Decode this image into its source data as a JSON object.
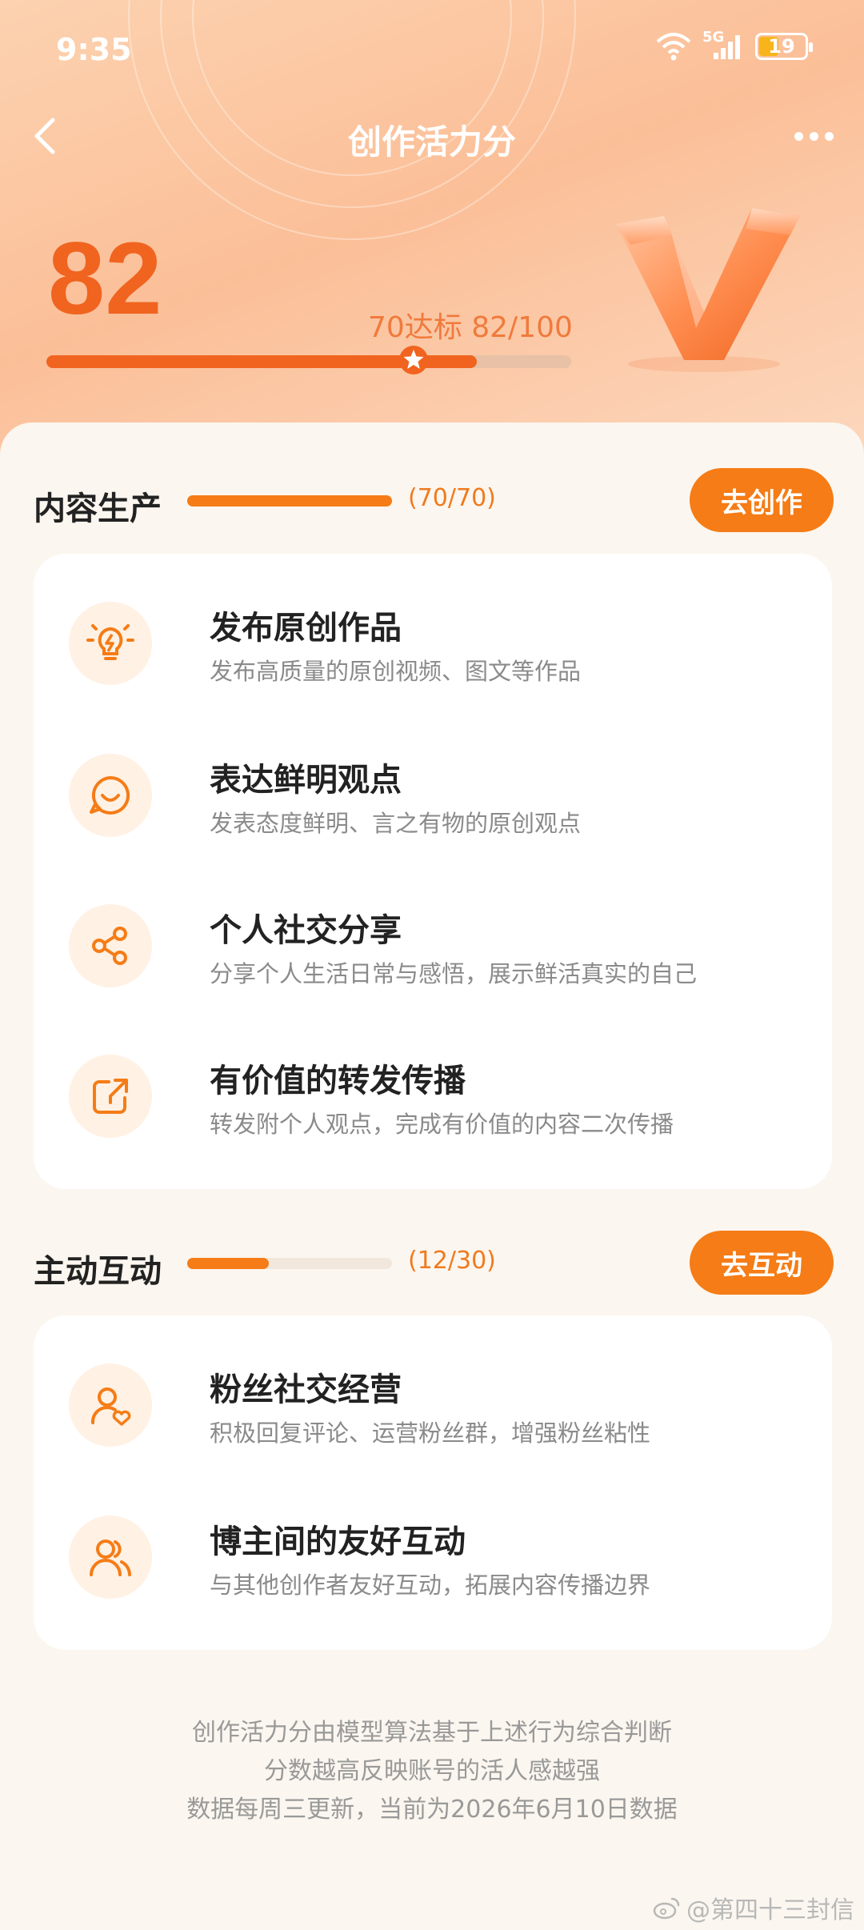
{
  "status_bar": {
    "time": "9:35",
    "network": "5G",
    "battery": "19"
  },
  "nav": {
    "title": "创作活力分"
  },
  "score": {
    "value": "82",
    "target_text": "70达标  82/100",
    "progress_fraction": 0.82,
    "target_fraction": 0.7
  },
  "sections": [
    {
      "title": "内容生产",
      "count": "(70/70)",
      "progress_fraction": 1.0,
      "button": "去创作",
      "items": [
        {
          "icon": "lightbulb-icon",
          "title": "发布原创作品",
          "desc": "发布高质量的原创视频、图文等作品"
        },
        {
          "icon": "smile-chat-icon",
          "title": "表达鲜明观点",
          "desc": "发表态度鲜明、言之有物的原创观点"
        },
        {
          "icon": "share-icon",
          "title": "个人社交分享",
          "desc": "分享个人生活日常与感悟，展示鲜活真实的自己"
        },
        {
          "icon": "repost-icon",
          "title": "有价值的转发传播",
          "desc": "转发附个人观点，完成有价值的内容二次传播"
        }
      ]
    },
    {
      "title": "主动互动",
      "count": "(12/30)",
      "progress_fraction": 0.4,
      "button": "去互动",
      "items": [
        {
          "icon": "fan-heart-icon",
          "title": "粉丝社交经营",
          "desc": "积极回复评论、运营粉丝群，增强粉丝粘性"
        },
        {
          "icon": "users-icon",
          "title": "博主间的友好互动",
          "desc": "与其他创作者友好互动，拓展内容传播边界"
        }
      ]
    }
  ],
  "footer": {
    "lines": [
      "创作活力分由模型算法基于上述行为综合判断",
      "分数越高反映账号的活人感越强",
      "数据每周三更新，当前为2026年6月10日数据"
    ]
  },
  "watermark": "@第四十三封信",
  "colors": {
    "accent": "#f57c16",
    "score": "#f0641f",
    "icon_bg": "#fff1e4"
  }
}
